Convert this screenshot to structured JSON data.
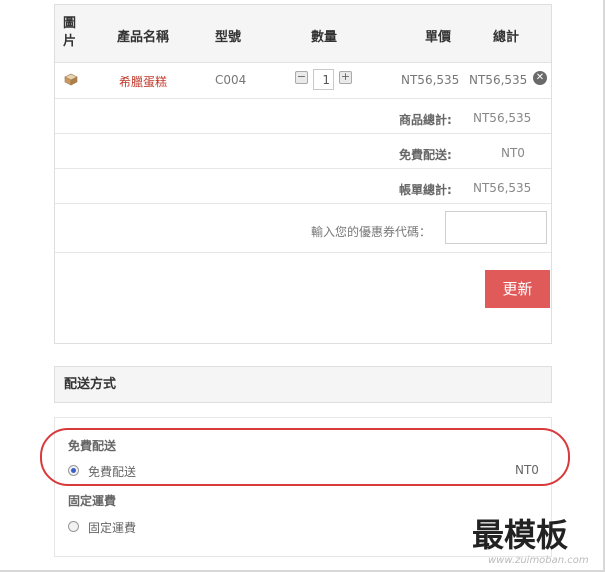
{
  "cart": {
    "headers": {
      "image": "圖\n片",
      "name": "產品名稱",
      "model": "型號",
      "quantity": "數量",
      "unit_price": "單價",
      "total": "總計"
    },
    "item": {
      "thumbnail_icon": "cake-icon",
      "name": "希臘蛋糕",
      "model": "C004",
      "quantity": "1",
      "unit_price": "NT56,535",
      "total": "NT56,535"
    },
    "summary": {
      "subtotal_label": "商品總計:",
      "subtotal_value": "NT56,535",
      "shipping_label": "免費配送:",
      "shipping_value": "NT0",
      "grand_label": "帳單總計:",
      "grand_value": "NT56,535"
    },
    "coupon_label": "輸入您的優惠券代碼：",
    "coupon_value": "",
    "update_button": "更新"
  },
  "shipping": {
    "title": "配送方式",
    "groups": [
      {
        "heading": "免費配送",
        "option": "免費配送",
        "price": "NT0",
        "selected": true
      },
      {
        "heading": "固定運費",
        "option": "固定運費",
        "selected": false
      }
    ]
  },
  "watermark": {
    "main": "最模板",
    "sub": "www.zuimoban.com"
  },
  "colors": {
    "accent_button": "#e05a5a",
    "product_link": "#c0392b",
    "highlight": "#d83a3a"
  }
}
